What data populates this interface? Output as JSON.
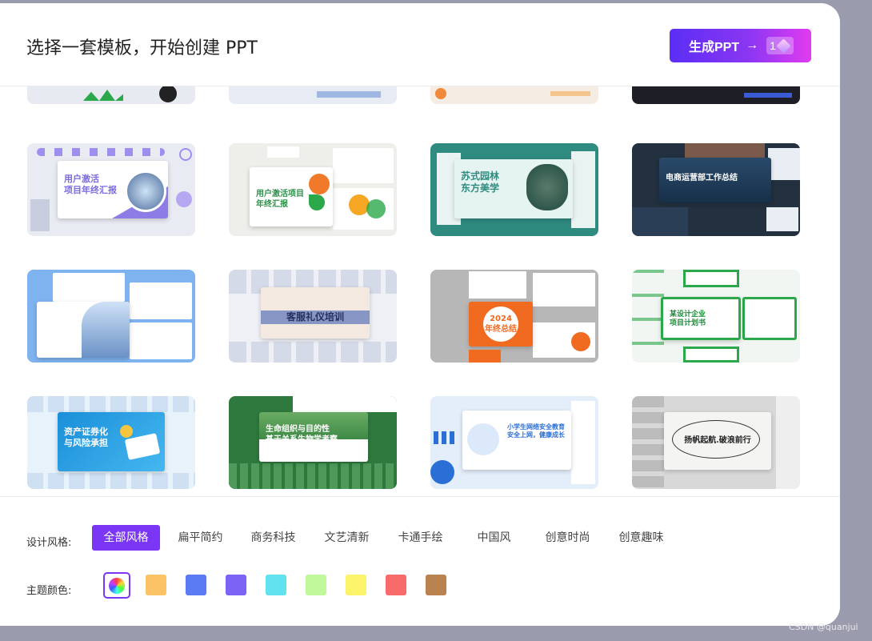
{
  "header": {
    "title": "选择一套模板，开始创建 PPT",
    "generate_label": "生成PPT",
    "generate_arrow": "→",
    "credit_count": "1"
  },
  "templates": [
    {
      "title": "用户激活\n项目年终汇报",
      "bg": "#e9ebf3",
      "accent": "#7a6be0"
    },
    {
      "title": "用户激活项目\n年终汇报",
      "bg": "#eeeeea",
      "accent": "#2f8f4a"
    },
    {
      "title": "苏式园林\n东方美学",
      "bg": "#2f8a80",
      "accent": "#2f8a80"
    },
    {
      "title": "电商运营部工作总结",
      "bg": "#22303f",
      "accent": "#1f6fb8"
    },
    {
      "title": "",
      "bg": "#7fb3f0",
      "accent": "#2a68d6"
    },
    {
      "title": "客服礼仪培训",
      "bg": "#eef0f6",
      "accent": "#4a5a8a"
    },
    {
      "title": "2024\n年终总结",
      "bg": "#b7b7b7",
      "accent": "#f06a1f"
    },
    {
      "title": "某设计企业\n项目计划书",
      "bg": "#f2f6f2",
      "accent": "#2aa84a"
    },
    {
      "title": "资产证券化\n与风险承担",
      "bg": "#e8f2fb",
      "accent": "#1c8fd8"
    },
    {
      "title": "生命组织与目的性\n基于关系生物学考察",
      "bg": "#2e7a3e",
      "accent": "#2e7a3e"
    },
    {
      "title": "小学生网络安全教育\n安全上网，健康成长",
      "bg": "#e4eefb",
      "accent": "#2a6fd6"
    },
    {
      "title": "扬帆起航.破浪前行",
      "bg": "#d8d8d8",
      "accent": "#333333"
    }
  ],
  "filters": {
    "style_label": "设计风格:",
    "styles": [
      "全部风格",
      "扁平简约",
      "商务科技",
      "文艺清新",
      "卡通手绘",
      "中国风",
      "创意时尚",
      "创意趣味"
    ],
    "color_label": "主题颜色:",
    "colors": [
      "#fcc266",
      "#5b7bf5",
      "#7c63f5",
      "#62e1ef",
      "#c0f79a",
      "#fbf36a",
      "#f76b6b",
      "#b9824f"
    ]
  },
  "watermark": "CSDN @quanjui"
}
